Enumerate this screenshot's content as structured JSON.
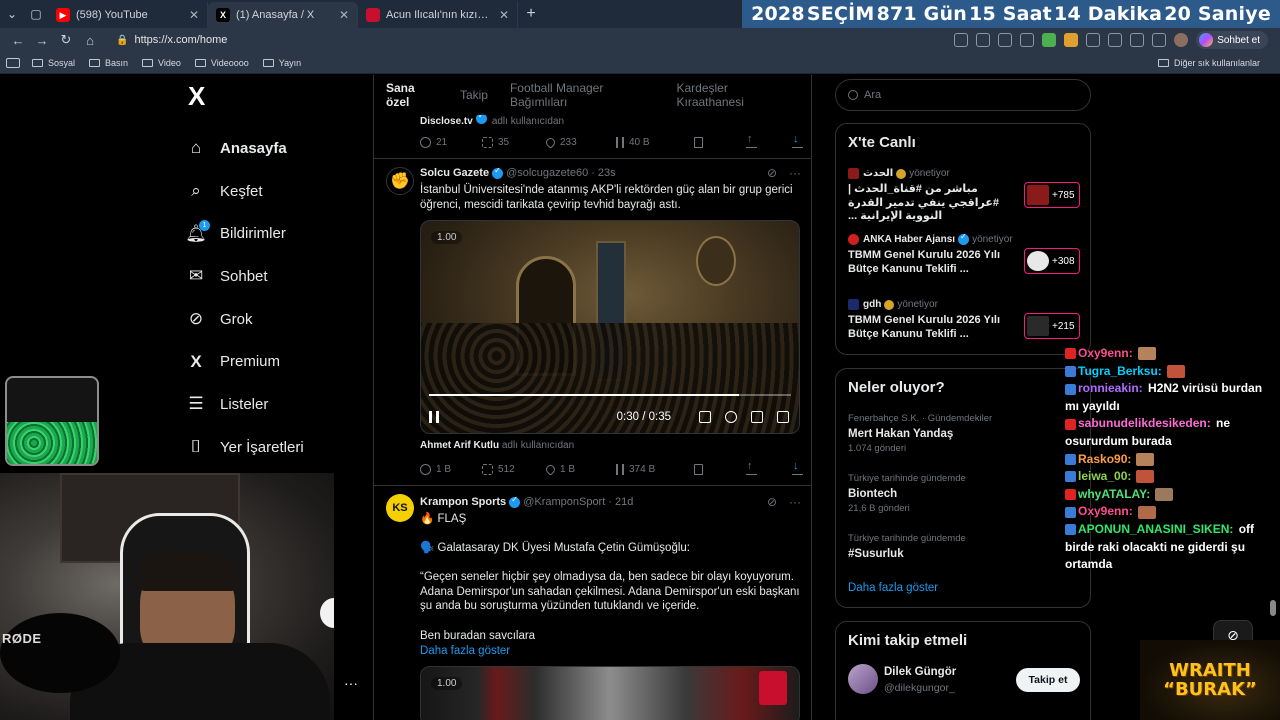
{
  "browser": {
    "tabs": [
      {
        "title": "(598) YouTube",
        "favicon_color": "#ff0000",
        "active": false
      },
      {
        "title": "(1) Anasayfa / X",
        "favicon_color": "#000000",
        "active": true
      },
      {
        "title": "Acun Ilıcalı'nın kızının çakarlı aracı",
        "favicon_color": "#c8102e",
        "active": false
      }
    ],
    "url": "https://x.com/home",
    "copilot_label": "Sohbet et",
    "bookmarks": [
      "Sosyal",
      "Basın",
      "Video",
      "Videoooo",
      "Yayın"
    ],
    "other_bookmarks": "Diğer sık kullanılanlar"
  },
  "countdown": {
    "year": "2028",
    "label": "SEÇİM",
    "days": "871 Gün",
    "hours": "15 Saat",
    "minutes": "14 Dakika",
    "seconds": "20 Saniye",
    "bg_color": "#2c5a8a"
  },
  "nav": {
    "logo": "X",
    "items": [
      {
        "label": "Anasayfa",
        "icon": "home-icon"
      },
      {
        "label": "Keşfet",
        "icon": "search-icon"
      },
      {
        "label": "Bildirimler",
        "icon": "bell-icon",
        "badge": "1"
      },
      {
        "label": "Sohbet",
        "icon": "mail-icon"
      },
      {
        "label": "Grok",
        "icon": "grok-icon"
      },
      {
        "label": "Premium",
        "icon": "x-icon"
      },
      {
        "label": "Listeler",
        "icon": "list-icon"
      },
      {
        "label": "Yer İşaretleri",
        "icon": "bookmark-icon"
      }
    ]
  },
  "feed": {
    "tabs": [
      "Sana özel",
      "Takip",
      "Football Manager Bağımlıları",
      "Kardeşler Kıraathanesi"
    ],
    "prev_tweet": {
      "source": "Disclose.tv",
      "source_suffix": "adlı kullanıcıdan",
      "replies": "21",
      "reposts": "35",
      "likes": "233",
      "views": "40 B"
    },
    "tweet1": {
      "name": "Solcu Gazete",
      "handle": "@solcugazete60",
      "time": "· 23s",
      "text": "İstanbul Üniversitesi'nde atanmış AKP'li rektörden güç alan bir grup gerici öğrenci, mescidi tarikata çevirip tevhid bayrağı astı.",
      "video_speed": "1.00",
      "video_time": "0:30 / 0:35",
      "video_progress": 0.857,
      "credit_name": "Ahmet Arif Kutlu",
      "credit_suffix": "adlı kullanıcıdan",
      "replies": "1 B",
      "reposts": "512",
      "likes": "1 B",
      "views": "374 B"
    },
    "tweet2": {
      "name": "Krampon Sports",
      "handle": "@KramponSport",
      "time": "· 21d",
      "flash": "🔥 FLAŞ",
      "line1": "🗣️ Galatasaray DK Üyesi Mustafa Çetin Gümüşoğlu:",
      "quote": "“Geçen seneler hiçbir şey olmadıysa da, ben sadece bir olayı koyuyorum. Adana Demirspor'un sahadan çekilmesi. Adana Demirspor'un eski başkanı şu anda bu soruşturma yüzünden tutuklandı ve içeride.",
      "line3": "Ben buradan savcılara",
      "more": "Daha fazla göster",
      "video_speed": "1.00"
    }
  },
  "right": {
    "search_placeholder": "Ara",
    "live": {
      "title": "X'te Canlı",
      "items": [
        {
          "who": "الحدث",
          "status": "yönetiyor",
          "title": "مباشر من #قناة_الحدث | #عراقجي ينفي تدمير القدرة النووية الإيرانية ...",
          "count": "+785",
          "rtl": true
        },
        {
          "who": "ANKA Haber Ajansı",
          "status": "yönetiyor",
          "title": "TBMM Genel Kurulu 2026 Yılı Bütçe Kanunu Teklifi ...",
          "count": "+308",
          "rtl": false
        },
        {
          "who": "gdh",
          "status": "yönetiyor",
          "title": "TBMM Genel Kurulu 2026 Yılı Bütçe Kanunu Teklifi ...",
          "count": "+215",
          "rtl": false
        }
      ]
    },
    "trends": {
      "title": "Neler oluyor?",
      "items": [
        {
          "category": "Fenerbahçe S.K. · Gündemdekiler",
          "name": "Mert Hakan Yandaş",
          "count": "1.074 gönderi"
        },
        {
          "category": "Türkiye tarihinde gündemde",
          "name": "Biontech",
          "count": "21,6 B gönderi"
        },
        {
          "category": "Türkiye tarihinde gündemde",
          "name": "#Susurluk",
          "count": ""
        }
      ],
      "more": "Daha fazla göster"
    },
    "who_to_follow": {
      "title": "Kimi takip etmeli",
      "name": "Dilek Güngör",
      "handle": "@dilekgungor_",
      "button": "Takip et"
    }
  },
  "stream": {
    "webcam_label": "RØDE",
    "brand_line1": "WRAITH",
    "brand_line2": "“BURAK”",
    "chat": [
      {
        "user": "Oxy9enn:",
        "color": "#ff4d8d",
        "msg": ""
      },
      {
        "user": "Tugra_Berksu:",
        "color": "#00d0ff",
        "msg": ""
      },
      {
        "user": "ronnieakin:",
        "color": "#b36bff",
        "msg": "H2N2 virüsü burdan mı yayıldı"
      },
      {
        "user": "sabunudelikdesikeden:",
        "color": "#ff6bd5",
        "msg": "ne osururdum burada"
      },
      {
        "user": "Rasko90:",
        "color": "#ff9f43",
        "msg": ""
      },
      {
        "user": "leiwa_00:",
        "color": "#8fd14f",
        "msg": ""
      },
      {
        "user": "whyATALAY:",
        "color": "#4de37a",
        "msg": ""
      },
      {
        "user": "Oxy9enn:",
        "color": "#ff4d8d",
        "msg": ""
      },
      {
        "user": "APONUN_ANASINI_SIKEN:",
        "color": "#2ee86b",
        "msg": "off birde raki olacakti ne giderdi şu ortamda"
      }
    ]
  }
}
